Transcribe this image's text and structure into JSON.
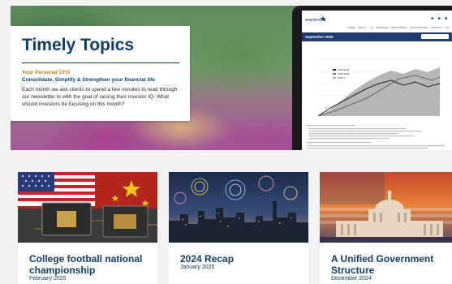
{
  "hero": {
    "title": "Timely Topics",
    "subtitle1": "Your Personal CFO",
    "subtitle2": "Consolidate, Simplify & Strengthen your financial life",
    "description": "Each month we ask clients to spend a few minutes to read through our newsletter to with the goal of raising their investor IQ. What should investors be focusing on this month?"
  },
  "newsletter": {
    "brand": "NORTH STAR",
    "month_title": "September 2020",
    "nav": "HOME  ABOUT US  SERVICES  RESOURCES  PUBLICATIONS  CONTACT US",
    "legend": [
      "1929-1942",
      "1982-2000",
      "2000-?"
    ]
  },
  "cards": [
    {
      "title": "College football national championship",
      "date": "February 2025"
    },
    {
      "title": "2024 Recap",
      "date": "January 2025"
    },
    {
      "title": "A Unified Government Structure",
      "date": "December 2024"
    }
  ]
}
